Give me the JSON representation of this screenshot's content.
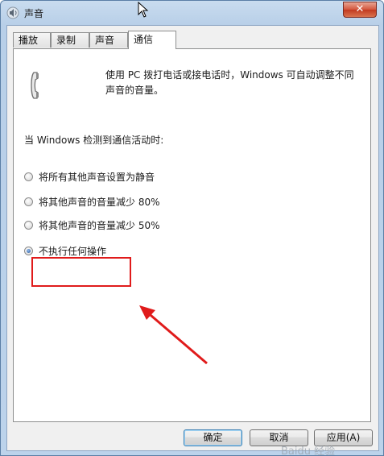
{
  "window": {
    "title": "声音",
    "close_label": "✕"
  },
  "tabs": [
    {
      "label": "播放",
      "active": false
    },
    {
      "label": "录制",
      "active": false
    },
    {
      "label": "声音",
      "active": false
    },
    {
      "label": "通信",
      "active": true
    }
  ],
  "panel": {
    "description": "使用 PC 拨打电话或接电话时，Windows 可自动调整不同声音的音量。",
    "detect_label": "当 Windows 检测到通信活动时:",
    "options": [
      {
        "label": "将所有其他声音设置为静音",
        "checked": false
      },
      {
        "label": "将其他声音的音量减少 80%",
        "checked": false
      },
      {
        "label": "将其他声音的音量减少 50%",
        "checked": false
      },
      {
        "label": "不执行任何操作",
        "checked": true
      }
    ]
  },
  "buttons": {
    "ok": "确定",
    "cancel": "取消",
    "apply": "应用(A)"
  },
  "watermark": "Baidu 经验",
  "colors": {
    "highlight": "#e01b1b",
    "title_bar": "#c9dcef",
    "accent": "#1c4f9a"
  }
}
